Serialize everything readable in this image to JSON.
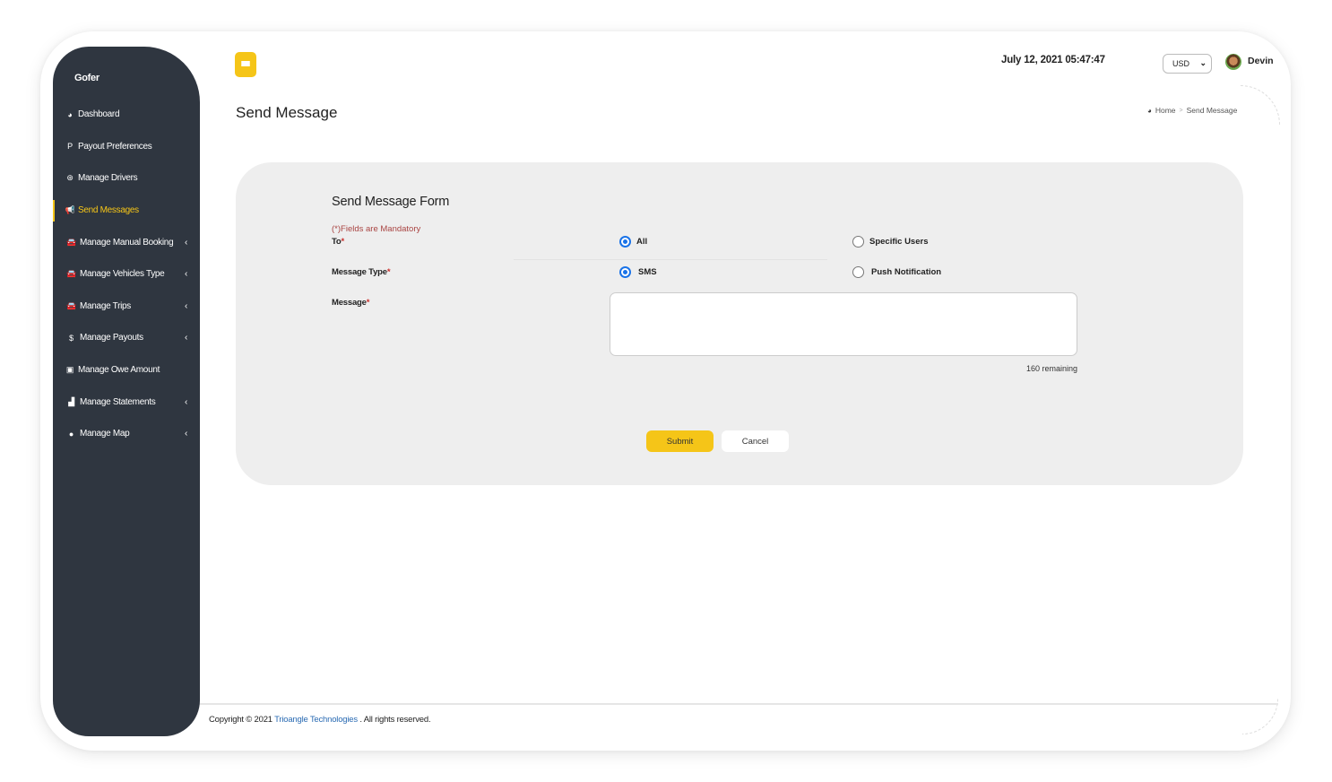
{
  "app": {
    "brand": "Gofer"
  },
  "sidebar": {
    "items": [
      {
        "label": "Dashboard",
        "icon": "dashboard-icon",
        "glyph": "◕",
        "active": false,
        "has_submenu": false
      },
      {
        "label": "Payout Preferences",
        "icon": "paypal-icon",
        "glyph": "P",
        "active": false,
        "has_submenu": false
      },
      {
        "label": "Manage Drivers",
        "icon": "steering-wheel-icon",
        "glyph": "⊛",
        "active": false,
        "has_submenu": false
      },
      {
        "label": "Send Messages",
        "icon": "megaphone-icon",
        "glyph": "📢",
        "active": true,
        "has_submenu": false
      },
      {
        "label": "Manage Manual Booking",
        "icon": "car-icon",
        "glyph": "🚘",
        "active": false,
        "has_submenu": true
      },
      {
        "label": "Manage Vehicles Type",
        "icon": "car-icon",
        "glyph": "🚘",
        "active": false,
        "has_submenu": true
      },
      {
        "label": "Manage Trips",
        "icon": "car-icon",
        "glyph": "🚘",
        "active": false,
        "has_submenu": true
      },
      {
        "label": "Manage Payouts",
        "icon": "dollar-icon",
        "glyph": "$",
        "active": false,
        "has_submenu": true
      },
      {
        "label": "Manage Owe Amount",
        "icon": "money-bill-icon",
        "glyph": "▣",
        "active": false,
        "has_submenu": false
      },
      {
        "label": "Manage Statements",
        "icon": "area-chart-icon",
        "glyph": "▟",
        "active": false,
        "has_submenu": true
      },
      {
        "label": "Manage Map",
        "icon": "map-marker-icon",
        "glyph": "●",
        "active": false,
        "has_submenu": true
      }
    ],
    "chevron": "‹"
  },
  "header": {
    "menu_icon": "hamburger-icon",
    "datetime": "July 12, 2021 05:47:47",
    "currency": {
      "selected": "USD",
      "chevron": "⌄"
    },
    "user": {
      "name": "Devin"
    }
  },
  "page": {
    "title": "Send Message",
    "breadcrumb": {
      "home": "Home",
      "separator": ">",
      "current": "Send Message"
    }
  },
  "form": {
    "title": "Send Message Form",
    "mandatory_note": "(*)Fields are Mandatory",
    "required_mark": "*",
    "to": {
      "label": "To",
      "options": [
        {
          "label": "All",
          "checked": true
        },
        {
          "label": "Specific Users",
          "checked": false
        }
      ]
    },
    "message_type": {
      "label": "Message Type",
      "options": [
        {
          "label": "SMS",
          "checked": true
        },
        {
          "label": "Push Notification",
          "checked": false
        }
      ]
    },
    "message": {
      "label": "Message",
      "value": "",
      "placeholder": "",
      "remaining": "160 remaining"
    },
    "submit_label": "Submit",
    "cancel_label": "Cancel"
  },
  "footer": {
    "prefix": "Copyright © 2021 ",
    "company": "Trioangle Technologies",
    "suffix": " . All rights reserved."
  },
  "colors": {
    "accent": "#f5c518",
    "sidebar_bg": "#2f3640",
    "card_bg": "#eeeeee",
    "radio_checked": "#1a73e8",
    "mandatory_text": "#a94442",
    "link": "#2a6bb3"
  }
}
